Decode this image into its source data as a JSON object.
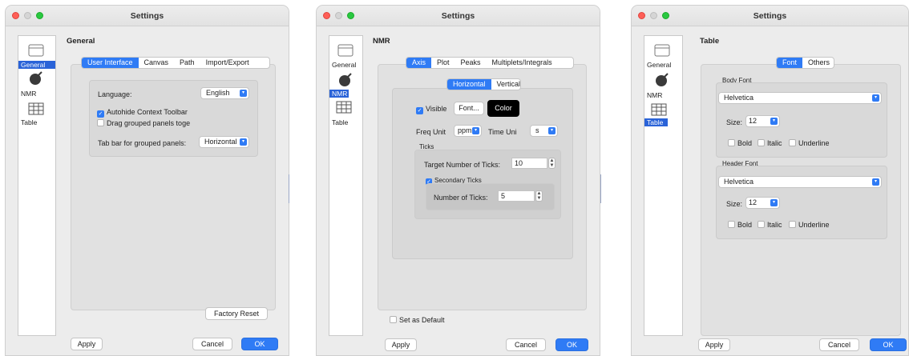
{
  "window_title": "Settings",
  "sidebar": [
    {
      "label": "General",
      "icon": "window-icon"
    },
    {
      "label": "NMR",
      "icon": "nmr-icon"
    },
    {
      "label": "Table",
      "icon": "table-icon"
    }
  ],
  "colors": {
    "accent": "#2f7bf5",
    "selection": "#2a63d8"
  },
  "general": {
    "title": "General",
    "tabs": [
      "User Interface",
      "Canvas",
      "Path",
      "Import/Export"
    ],
    "language_label": "Language:",
    "language_value": "English",
    "autohide_label": "Autohide Context Toolbar",
    "autohide_checked": true,
    "drag_label": "Drag grouped panels toge",
    "drag_checked": false,
    "tabbar_label": "Tab bar for grouped panels:",
    "tabbar_value": "Horizontal",
    "factory_reset": "Factory Reset",
    "apply": "Apply",
    "cancel": "Cancel",
    "ok": "OK"
  },
  "nmr": {
    "title": "NMR",
    "tabs": [
      "Axis",
      "Plot",
      "Peaks",
      "Multiplets/Integrals"
    ],
    "orientation_tabs": [
      "Horizontal",
      "Vertical"
    ],
    "visible_label": "Visible",
    "font_button": "Font...",
    "color_button": "Color",
    "freq_unit_label": "Freq Unit",
    "freq_unit_value": "ppm",
    "time_unit_label": "Time Uni",
    "time_unit_value": "s",
    "ticks_label": "Ticks",
    "target_ticks_label": "Target Number of Ticks:",
    "target_ticks_value": "10",
    "secondary_ticks_label": "Secondary Ticks",
    "number_ticks_label": "Number of Ticks:",
    "number_ticks_value": "5",
    "set_default_label": "Set as Default",
    "apply": "Apply",
    "cancel": "Cancel",
    "ok": "OK"
  },
  "table": {
    "title": "Table",
    "tabs": [
      "Font",
      "Others"
    ],
    "body_font_label": "Body Font",
    "body_font_value": "Helvetica",
    "body_size_label": "Size:",
    "body_size_value": "12",
    "header_font_label": "Header Font",
    "header_font_value": "Helvetica",
    "header_size_label": "Size:",
    "header_size_value": "12",
    "bold_label": "Bold",
    "italic_label": "Italic",
    "underline_label": "Underline",
    "apply": "Apply",
    "cancel": "Cancel",
    "ok": "OK"
  }
}
